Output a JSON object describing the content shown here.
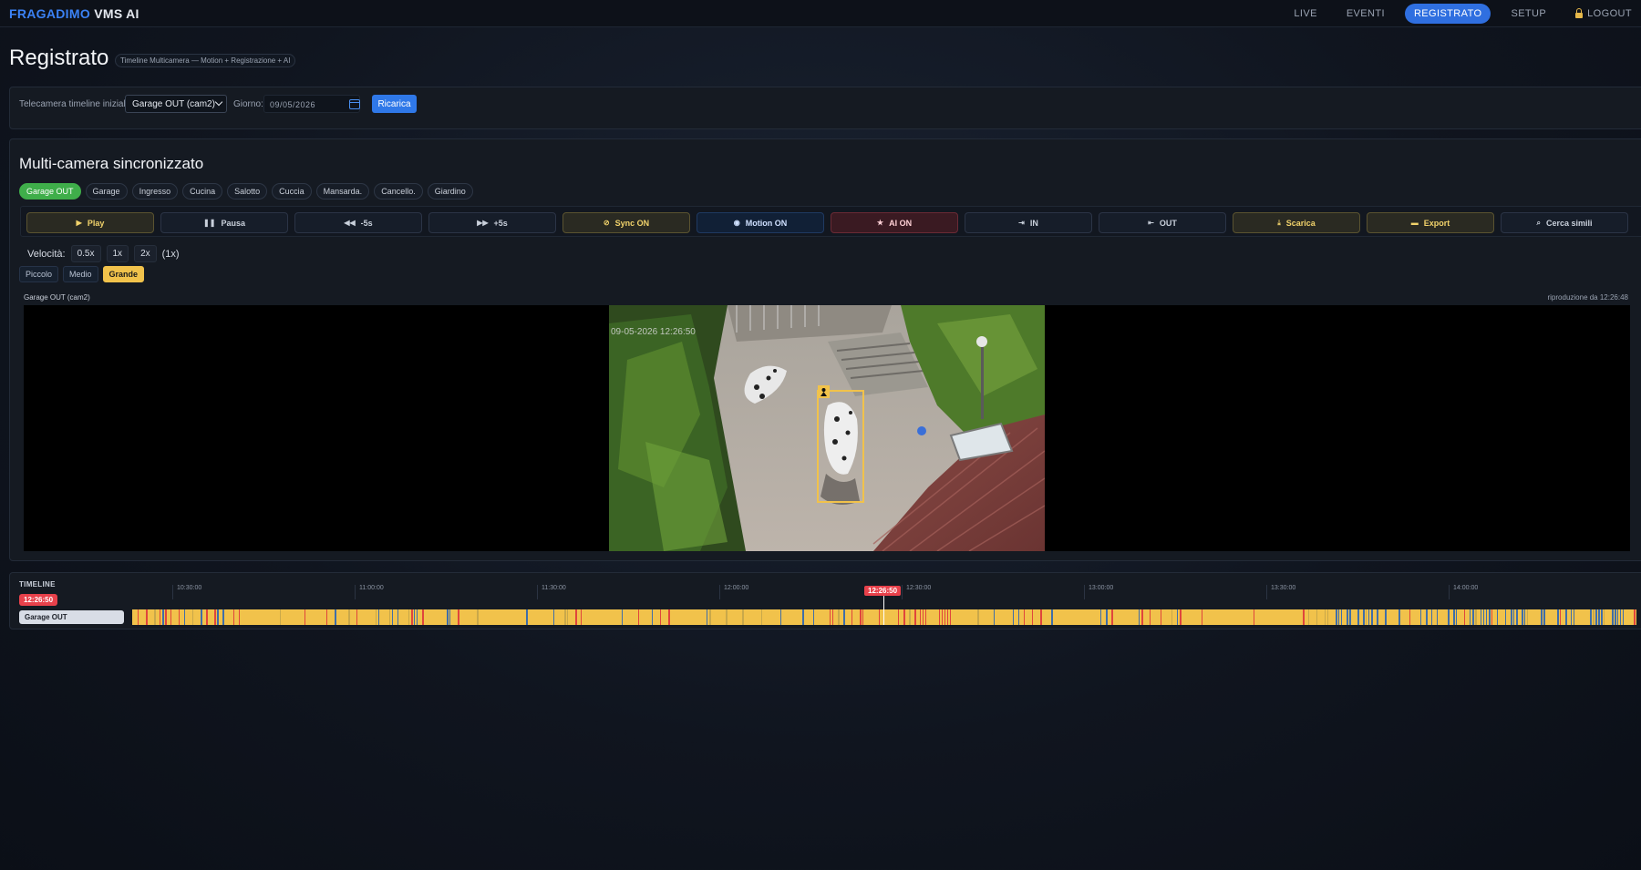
{
  "app": {
    "brand_part1": "FRAGADIMO",
    "brand_part2": " VMS AI"
  },
  "nav": {
    "live": "LIVE",
    "eventi": "EVENTI",
    "registrato": "REGISTRATO",
    "setup": "SETUP",
    "logout": "LOGOUT"
  },
  "page": {
    "title": "Registrato",
    "breadcrumb": "Timeline Multicamera — Motion + Registrazione + AI"
  },
  "filters": {
    "camera_label": "Telecamera timeline iniziale:",
    "camera_value": "Garage OUT (cam2)",
    "day_label": "Giorno:",
    "day_value": "09/05/2026",
    "reload_label": "Ricarica"
  },
  "multicam": {
    "title": "Multi-camera sincronizzato",
    "cameras": [
      "Garage OUT",
      "Garage",
      "Ingresso",
      "Cucina",
      "Salotto",
      "Cuccia",
      "Mansarda.",
      "Cancello.",
      "Giardino"
    ],
    "active_camera_index": 0
  },
  "controls": {
    "play": "Play",
    "pause": "Pausa",
    "back5": "-5s",
    "fwd5": "+5s",
    "sync": "Sync ON",
    "motion": "Motion ON",
    "ai": "AI ON",
    "in": "IN",
    "out": "OUT",
    "download": "Scarica",
    "export": "Export",
    "similar": "Cerca simili"
  },
  "speed": {
    "label": "Velocità:",
    "options": [
      "0.5x",
      "1x",
      "2x"
    ],
    "current": "(1x)"
  },
  "sizes": {
    "options": [
      "Piccolo",
      "Medio",
      "Grande"
    ],
    "active": "Grande"
  },
  "player": {
    "camera_label": "Garage OUT (cam2)",
    "playback_info": "riproduzione da 12:26:48",
    "overlay_timestamp": "09-05-2026 12:26:50"
  },
  "timeline": {
    "title": "TIMELINE",
    "current_time": "12:26:50",
    "row_label": "Garage OUT",
    "ticks": [
      "10:30:00",
      "11:00:00",
      "11:30:00",
      "12:00:00",
      "12:30:00",
      "13:00:00",
      "13:30:00",
      "14:00:00"
    ],
    "colors": {
      "recording": "#f1c24b",
      "motion": "#e0453c",
      "ai": "#3f6ea8"
    }
  },
  "colors": {
    "accent": "#2f6fe0",
    "gold": "#f1c24b",
    "active_chip": "#3fae4a",
    "alert": "#e8414b"
  }
}
